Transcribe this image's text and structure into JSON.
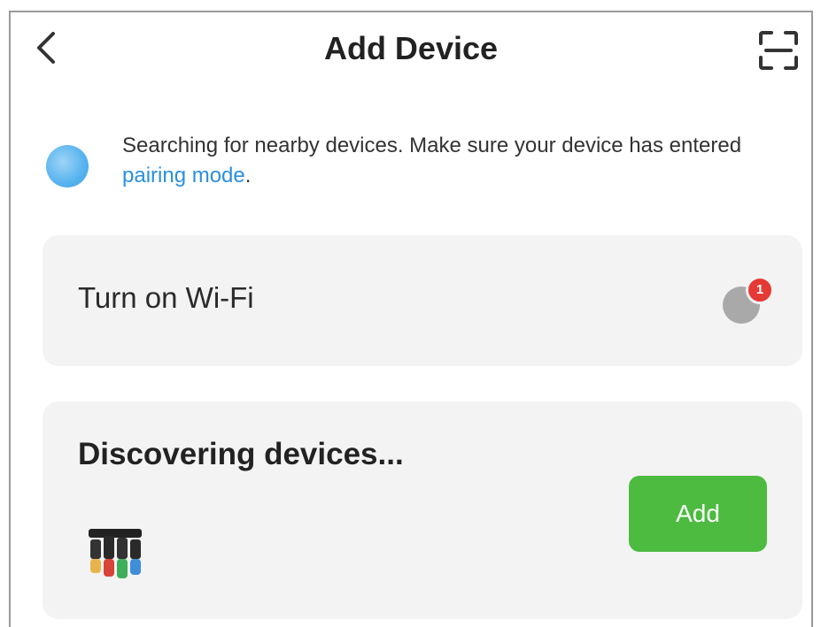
{
  "header": {
    "title": "Add Device"
  },
  "notice": {
    "text_before_link": "Searching for nearby devices. Make sure your device has entered ",
    "link_text": "pairing mode",
    "text_after_link": "."
  },
  "wifi_card": {
    "label": "Turn on Wi-Fi",
    "badge_count": "1"
  },
  "discover_card": {
    "label": "Discovering devices...",
    "add_label": "Add"
  },
  "colors": {
    "accent_green": "#4cbb3f",
    "link_blue": "#2a8fe0",
    "badge_red": "#e53935",
    "card_bg": "#f3f3f3"
  },
  "icons": {
    "back": "chevron-left-icon",
    "scan": "scan-frame-icon",
    "searching": "search-pulse-icon",
    "wifi": "wifi-status-icon",
    "device": "device-thumbnail-icon"
  }
}
